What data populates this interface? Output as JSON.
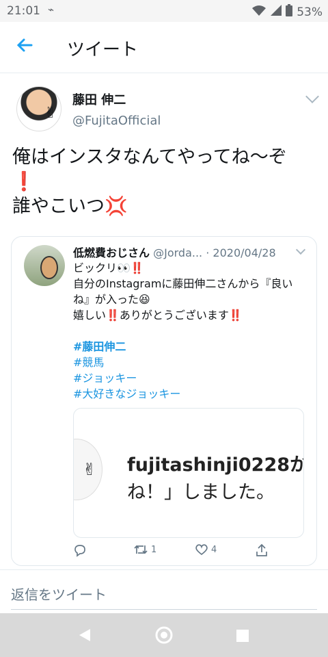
{
  "status": {
    "time": "21:01",
    "battery": "53%"
  },
  "appbar": {
    "title": "ツイート"
  },
  "tweet": {
    "author_name": "藤田 伸二",
    "author_handle": "@FujitaOfficial",
    "lines": [
      "俺はインスタなんてやってね〜ぞ",
      "❗",
      "誰やこいつ💢"
    ]
  },
  "quote": {
    "author_name": "低燃費おじさん",
    "author_handle": "@Jorda...",
    "date": "· 2020/04/28",
    "lines": [
      "ビックリ👀‼️",
      "自分のInstagramに藤田伸二さんから『良い",
      "ね』が入った😆",
      "嬉しい‼️ありがとうございます‼️",
      "",
      "#藤田伸二",
      "#競馬",
      "#ジョッキー",
      "#大好きなジョッキー"
    ],
    "card": {
      "line1": "fujitashinji0228か",
      "line2": "ね！」しました。"
    },
    "retweet_count": "1",
    "like_count": "4"
  },
  "reply": {
    "placeholder": "返信をツイート"
  },
  "colors": {
    "accent": "#1da1f2",
    "text": "#14171a",
    "muted": "#657786"
  }
}
